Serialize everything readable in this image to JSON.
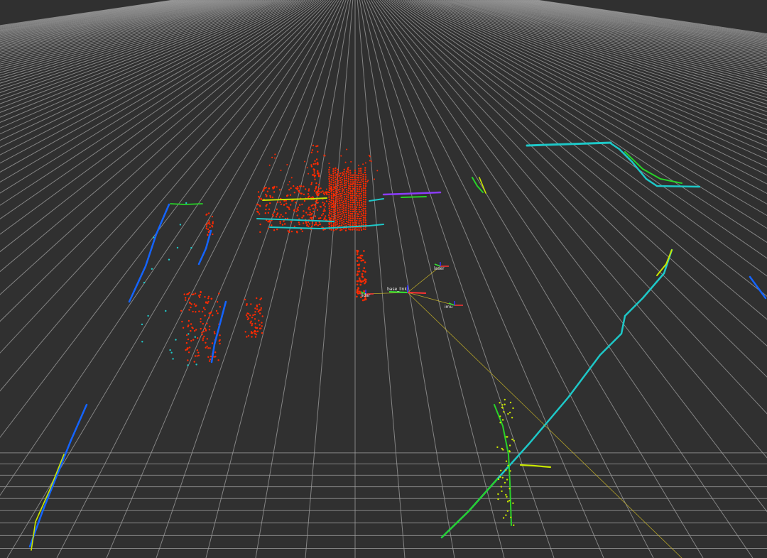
{
  "view": {
    "type": "3d-viewport",
    "background": "#303030",
    "grid_color": "#a0a0a0",
    "grid_visible": true
  },
  "colors": {
    "near": "#ff2a00",
    "yellow": "#c8e600",
    "green": "#28d228",
    "teal": "#1ec8c8",
    "blue": "#1464ff",
    "violet": "#8c3cff",
    "axis_x": "#ff3232",
    "axis_y": "#32e632",
    "axis_z": "#3232ff",
    "tf_link": "#c8b428"
  },
  "frames": [
    {
      "id": "base",
      "label": "base_link"
    },
    {
      "id": "f1",
      "label": "laser"
    },
    {
      "id": "f2",
      "label": "imu"
    },
    {
      "id": "f3",
      "label": "lidar"
    }
  ]
}
